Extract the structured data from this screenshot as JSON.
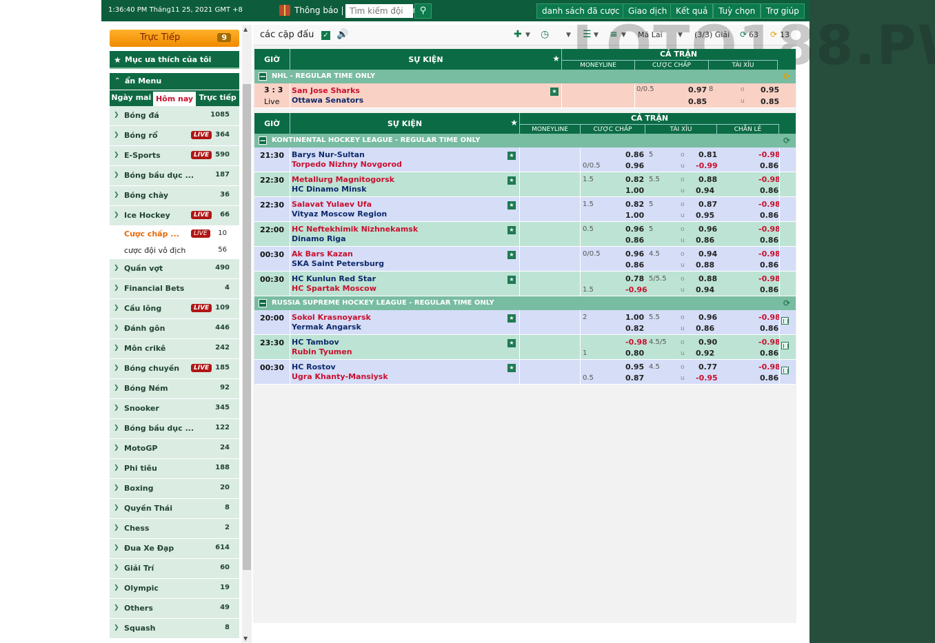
{
  "topbar": {
    "clock": "1:36:40 PM Tháng11 25, 2021 GMT +8",
    "notice": "Thông báo | Tin nhắn cá nhân",
    "search_placeholder": "Tìm kiếm đội",
    "buttons": [
      "danh sách đã cược",
      "Giao dịch",
      "Kết quả",
      "Tuỳ chọn",
      "Trợ giúp"
    ]
  },
  "sidebar": {
    "live_label": "Trực Tiếp",
    "live_count": "9",
    "favorites": "Mục ưa thích của tôi",
    "hide_menu": "ẩn Menu",
    "tabs": [
      "Ngày mai",
      "Hôm nay",
      "Trực tiếp"
    ],
    "sports": [
      {
        "name": "Bóng đá",
        "count": "1085",
        "live": ""
      },
      {
        "name": "Bóng rổ",
        "count": "364",
        "live": "LIVE"
      },
      {
        "name": "E-Sports",
        "count": "590",
        "live": "LIVE"
      },
      {
        "name": "Bóng bầu dục ...",
        "count": "187",
        "live": ""
      },
      {
        "name": "Bóng chày",
        "count": "36",
        "live": ""
      },
      {
        "name": "Ice Hockey",
        "count": "66",
        "live": "LIVE"
      }
    ],
    "subs": [
      {
        "name": "Cược chấp ...",
        "count": "10",
        "live": "LIVE"
      },
      {
        "name": "cược đội vô địch",
        "count": "56",
        "live": ""
      }
    ],
    "sports2": [
      {
        "name": "Quần vợt",
        "count": "490",
        "live": ""
      },
      {
        "name": "Financial Bets",
        "count": "4",
        "live": ""
      },
      {
        "name": "Cầu lông",
        "count": "109",
        "live": "LIVE"
      },
      {
        "name": "Đánh gôn",
        "count": "446",
        "live": ""
      },
      {
        "name": "Môn crikê",
        "count": "242",
        "live": ""
      },
      {
        "name": "Bóng chuyền",
        "count": "185",
        "live": "LIVE"
      },
      {
        "name": "Bóng Ném",
        "count": "92",
        "live": ""
      },
      {
        "name": "Snooker",
        "count": "345",
        "live": ""
      },
      {
        "name": "Bóng bầu dục ...",
        "count": "122",
        "live": ""
      },
      {
        "name": "MotoGP",
        "count": "24",
        "live": ""
      },
      {
        "name": "Phi tiêu",
        "count": "188",
        "live": ""
      },
      {
        "name": "Boxing",
        "count": "20",
        "live": ""
      },
      {
        "name": "Quyền Thái",
        "count": "8",
        "live": ""
      },
      {
        "name": "Chess",
        "count": "2",
        "live": ""
      },
      {
        "name": "Đua Xe Đạp",
        "count": "614",
        "live": ""
      },
      {
        "name": "Giải Trí",
        "count": "60",
        "live": ""
      },
      {
        "name": "Olympic",
        "count": "19",
        "live": ""
      },
      {
        "name": "Others",
        "count": "49",
        "live": ""
      },
      {
        "name": "Squash",
        "count": "8",
        "live": ""
      }
    ]
  },
  "controls": {
    "title": "các cặp đấu",
    "odds_type": "Mã Lai",
    "leagues": "(3/3) Giải",
    "refresh1": "63",
    "refresh2": "13"
  },
  "watermark": "LOTO188.PW",
  "headers": {
    "time": "GIỜ",
    "event": "SỰ KIỆN",
    "full_match": "CẢ TRẬN",
    "moneyline": "MONEYLINE",
    "handicap": "CƯỢC CHẤP",
    "ou": "TÀI XỈU",
    "oe": "CHẴN LẺ"
  },
  "live_table": {
    "league": "NHL - REGULAR TIME ONLY",
    "row": {
      "score": "3 : 3",
      "status": "Live",
      "home": "San Jose Sharks",
      "away": "Ottawa Senators",
      "hdp_line": "0/0.5",
      "hdp_home": "0.97",
      "hdp_away": "0.85",
      "ou_line": "8",
      "over_lbl": "o",
      "under_lbl": "u",
      "over": "0.95",
      "under": "0.85"
    }
  },
  "table2": {
    "leagues": [
      {
        "name": "KONTINENTAL HOCKEY LEAGUE - REGULAR TIME ONLY",
        "rows": [
          {
            "time": "21:30",
            "home": "Barys Nur-Sultan",
            "away": "Torpedo Nizhny Novgorod",
            "homeRed": false,
            "hdp_home_line": "",
            "hdp_away_line": "0/0.5",
            "hdp_home": "0.86",
            "hdp_away": "0.96",
            "hdp_away_red": false,
            "ou": "5",
            "over": "0.81",
            "under": "-0.99",
            "under_red": true,
            "odd": "-0.98",
            "even": "0.86",
            "chart": false
          },
          {
            "time": "22:30",
            "home": "Metallurg Magnitogorsk",
            "away": "HC Dinamo Minsk",
            "homeRed": true,
            "hdp_home_line": "1.5",
            "hdp_away_line": "",
            "hdp_home": "0.82",
            "hdp_away": "1.00",
            "hdp_away_red": false,
            "ou": "5.5",
            "over": "0.88",
            "under": "0.94",
            "under_red": false,
            "odd": "-0.98",
            "even": "0.86",
            "chart": false
          },
          {
            "time": "22:30",
            "home": "Salavat Yulaev Ufa",
            "away": "Vityaz Moscow Region",
            "homeRed": true,
            "hdp_home_line": "1.5",
            "hdp_away_line": "",
            "hdp_home": "0.82",
            "hdp_away": "1.00",
            "hdp_away_red": false,
            "ou": "5",
            "over": "0.87",
            "under": "0.95",
            "under_red": false,
            "odd": "-0.98",
            "even": "0.86",
            "chart": false
          },
          {
            "time": "22:00",
            "home": "HC Neftekhimik Nizhnekamsk",
            "away": "Dinamo Riga",
            "homeRed": true,
            "hdp_home_line": "0.5",
            "hdp_away_line": "",
            "hdp_home": "0.96",
            "hdp_away": "0.86",
            "hdp_away_red": false,
            "ou": "5",
            "over": "0.96",
            "under": "0.86",
            "under_red": false,
            "odd": "-0.98",
            "even": "0.86",
            "chart": false
          },
          {
            "time": "00:30",
            "home": "Ak Bars Kazan",
            "away": "SKA Saint Petersburg",
            "homeRed": true,
            "hdp_home_line": "0/0.5",
            "hdp_away_line": "",
            "hdp_home": "0.96",
            "hdp_away": "0.86",
            "hdp_away_red": false,
            "ou": "4.5",
            "over": "0.94",
            "under": "0.88",
            "under_red": false,
            "odd": "-0.98",
            "even": "0.86",
            "chart": false
          },
          {
            "time": "00:30",
            "home": "HC Kunlun Red Star",
            "away": "HC Spartak Moscow",
            "homeRed": false,
            "hdp_home_line": "",
            "hdp_away_line": "1.5",
            "hdp_home": "0.78",
            "hdp_away": "-0.96",
            "hdp_away_red": true,
            "ou": "5/5.5",
            "over": "0.88",
            "under": "0.94",
            "under_red": false,
            "odd": "-0.98",
            "even": "0.86",
            "chart": false
          }
        ]
      },
      {
        "name": "RUSSIA SUPREME HOCKEY LEAGUE - REGULAR TIME ONLY",
        "rows": [
          {
            "time": "20:00",
            "home": "Sokol Krasnoyarsk",
            "away": "Yermak Angarsk",
            "homeRed": true,
            "hdp_home_line": "2",
            "hdp_away_line": "",
            "hdp_home": "1.00",
            "hdp_away": "0.82",
            "hdp_away_red": false,
            "ou": "5.5",
            "over": "0.96",
            "under": "0.86",
            "under_red": false,
            "odd": "-0.98",
            "even": "0.86",
            "chart": true
          },
          {
            "time": "23:30",
            "home": "HC Tambov",
            "away": "Rubin Tyumen",
            "homeRed": false,
            "hdp_home_line": "",
            "hdp_away_line": "1",
            "hdp_home": "-0.98",
            "hdp_home_red": true,
            "hdp_away": "0.80",
            "hdp_away_red": false,
            "ou": "4.5/5",
            "over": "0.90",
            "under": "0.92",
            "under_red": false,
            "odd": "-0.98",
            "even": "0.86",
            "chart": true
          },
          {
            "time": "00:30",
            "home": "HC Rostov",
            "away": "Ugra Khanty-Mansiysk",
            "homeRed": false,
            "hdp_home_line": "",
            "hdp_away_line": "0.5",
            "hdp_home": "0.95",
            "hdp_away": "0.87",
            "hdp_away_red": false,
            "ou": "4.5",
            "over": "0.77",
            "under": "-0.95",
            "under_red": true,
            "odd": "-0.98",
            "even": "0.86",
            "chart": true
          }
        ]
      }
    ]
  }
}
